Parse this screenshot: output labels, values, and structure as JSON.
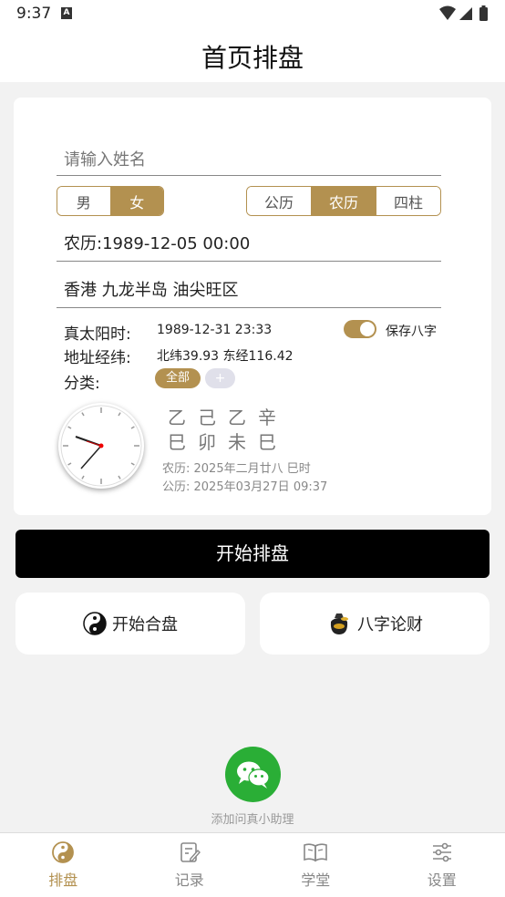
{
  "status_bar": {
    "time": "9:37",
    "notif_glyph": "A"
  },
  "header": {
    "title": "首页排盘"
  },
  "form": {
    "name_placeholder": "请输入姓名",
    "gender": {
      "male": "男",
      "female": "女",
      "selected": "女"
    },
    "calendar": {
      "gregorian": "公历",
      "lunar": "农历",
      "four_pillars": "四柱",
      "selected": "农历"
    },
    "date_value": "农历:1989-12-05 00:00",
    "place_value": "香港 九龙半岛 油尖旺区",
    "true_solar_label": "真太阳时:",
    "true_solar_value": "1989-12-31 23:33",
    "save_label": "保存八字",
    "save_enabled": true,
    "coord_label": "地址经纬:",
    "coord_value": "北纬39.93 东经116.42",
    "category_label": "分类:",
    "category_all": "全部",
    "category_add": "+"
  },
  "current": {
    "bazi_top": "乙己乙辛",
    "bazi_bottom": "巳卯未巳",
    "lunar_line": "农历: 2025年二月廿八 巳时",
    "solar_line": "公历: 2025年03月27日 09:37"
  },
  "actions": {
    "start_label": "开始排盘",
    "hepan_label": "开始合盘",
    "lucai_label": "八字论财"
  },
  "assistant": {
    "label": "添加问真小助理"
  },
  "tabs": [
    {
      "label": "排盘",
      "icon": "yin-yang-icon",
      "active": true
    },
    {
      "label": "记录",
      "icon": "record-icon",
      "active": false
    },
    {
      "label": "学堂",
      "icon": "book-icon",
      "active": false
    },
    {
      "label": "设置",
      "icon": "settings-sliders-icon",
      "active": false
    }
  ],
  "colors": {
    "accent": "#b39150",
    "primary_button": "#000000",
    "wechat": "#2aae36",
    "background": "#f2f2f2"
  }
}
